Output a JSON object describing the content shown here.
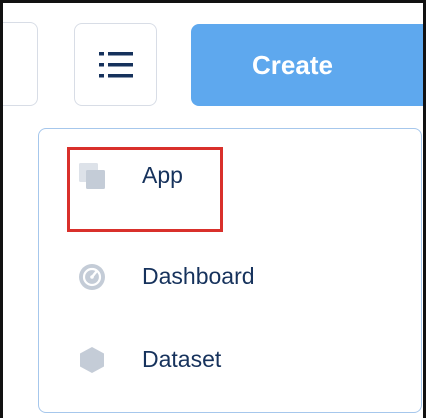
{
  "toolbar": {
    "list_view_icon": "list-icon",
    "create_label": "Create"
  },
  "menu": {
    "items": [
      {
        "label": "App",
        "icon": "app-icon"
      },
      {
        "label": "Dashboard",
        "icon": "dashboard-icon"
      },
      {
        "label": "Dataset",
        "icon": "dataset-icon"
      }
    ]
  },
  "colors": {
    "accent": "#5ea8ee",
    "menu_border": "#a6c7ec",
    "text": "#16325c",
    "icon": "#c4ccd7",
    "highlight": "#d9302b"
  }
}
